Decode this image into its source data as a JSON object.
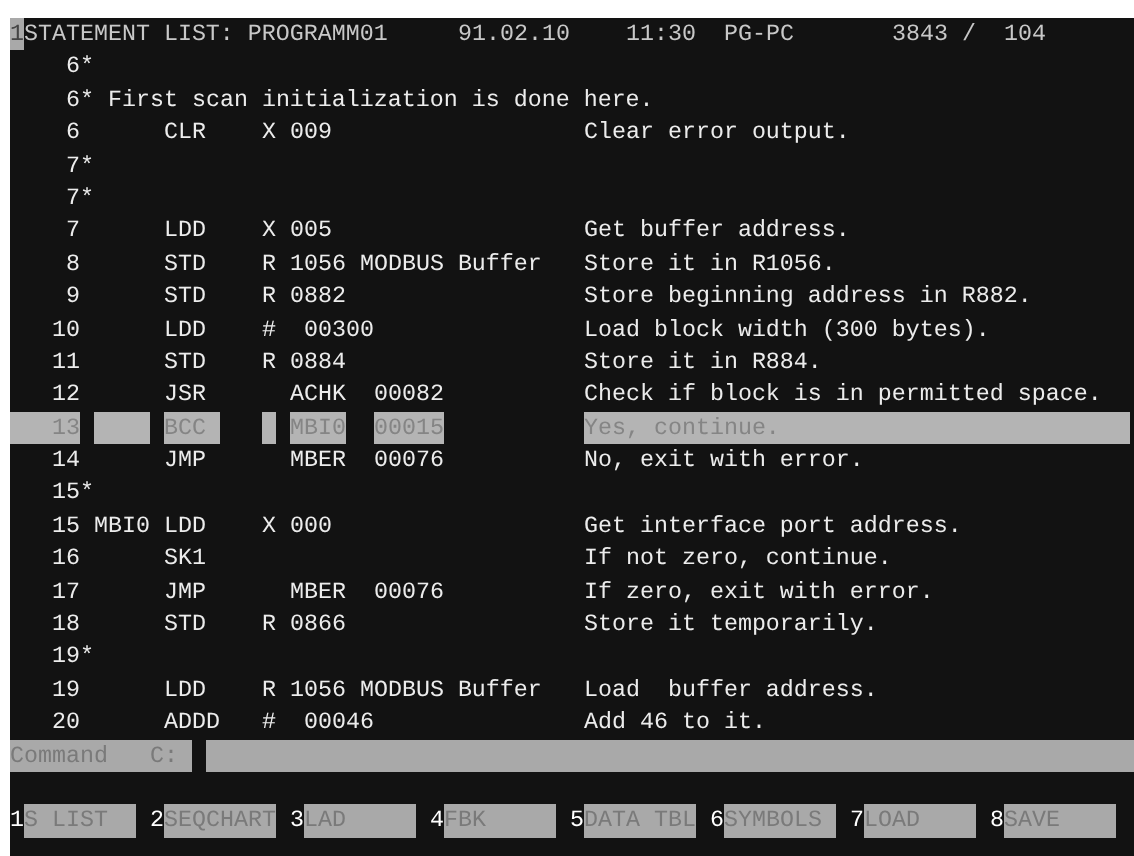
{
  "header": {
    "cursor": "1",
    "title": "STATEMENT LIST: PROGRAMM01",
    "date": "91.02.10",
    "time": "11:30",
    "station": "PG-PC",
    "counter": "3843 /  104"
  },
  "lines": [
    {
      "kind": "comment",
      "number": "6*",
      "selected": false
    },
    {
      "kind": "comment",
      "number": "6*",
      "text": "First scan initialization is done here.",
      "selected": false
    },
    {
      "kind": "statement",
      "number": "6",
      "op": "CLR",
      "type": "X",
      "value": "009",
      "comment": "Clear error output.",
      "selected": false
    },
    {
      "kind": "comment",
      "number": "7*",
      "selected": false
    },
    {
      "kind": "comment",
      "number": "7*",
      "selected": false
    },
    {
      "kind": "statement",
      "number": "7",
      "op": "LDD",
      "type": "X",
      "value": "005",
      "comment": "Get buffer address.",
      "selected": false
    },
    {
      "kind": "statement",
      "number": "8",
      "op": "STD",
      "type": "R",
      "value": "1056 MODBUS Buffer",
      "comment": "Store it in R1056.",
      "selected": false
    },
    {
      "kind": "statement",
      "number": "9",
      "op": "STD",
      "type": "R",
      "value": "0882",
      "comment": "Store beginning address in R882.",
      "selected": false
    },
    {
      "kind": "statement",
      "number": "10",
      "op": "LDD",
      "type": "#",
      "value": "00300",
      "comment": "Load block width (300 bytes).",
      "selected": false
    },
    {
      "kind": "statement",
      "number": "11",
      "op": "STD",
      "type": "R",
      "value": "0884",
      "comment": "Store it in R884.",
      "selected": false
    },
    {
      "kind": "statement",
      "number": "12",
      "op": "JSR",
      "symbol": "ACHK",
      "value": "00082",
      "comment": "Check if block is in permitted space.",
      "selected": false
    },
    {
      "kind": "statement",
      "number": "13",
      "op": "BCC",
      "symbol": "MBI0",
      "value": "00015",
      "comment": "Yes, continue.",
      "selected": true
    },
    {
      "kind": "statement",
      "number": "14",
      "op": "JMP",
      "symbol": "MBER",
      "value": "00076",
      "comment": "No, exit with error.",
      "selected": false
    },
    {
      "kind": "comment",
      "number": "15*",
      "selected": false
    },
    {
      "kind": "statement",
      "number": "15",
      "label": "MBI0",
      "op": "LDD",
      "type": "X",
      "value": "000",
      "comment": "Get interface port address.",
      "selected": false
    },
    {
      "kind": "statement",
      "number": "16",
      "op": "SK1",
      "comment": "If not zero, continue.",
      "selected": false
    },
    {
      "kind": "statement",
      "number": "17",
      "op": "JMP",
      "symbol": "MBER",
      "value": "00076",
      "comment": "If zero, exit with error.",
      "selected": false
    },
    {
      "kind": "statement",
      "number": "18",
      "op": "STD",
      "type": "R",
      "value": "0866",
      "comment": "Store it temporarily.",
      "selected": false
    },
    {
      "kind": "comment",
      "number": "19*",
      "selected": false
    },
    {
      "kind": "statement",
      "number": "19",
      "op": "LDD",
      "type": "R",
      "value": "1056 MODBUS Buffer",
      "comment": "Load  buffer address.",
      "selected": false
    },
    {
      "kind": "statement",
      "number": "20",
      "op": "ADDD",
      "type": "#",
      "value": "00046",
      "comment": "Add 46 to it.",
      "selected": false
    }
  ],
  "command": {
    "label": "Command",
    "drive": "C:"
  },
  "function_keys": [
    {
      "key": "1",
      "label": "S LIST"
    },
    {
      "key": "2",
      "label": "SEQCHART"
    },
    {
      "key": "3",
      "label": "LAD"
    },
    {
      "key": "4",
      "label": "FBK"
    },
    {
      "key": "5",
      "label": "DATA TBL"
    },
    {
      "key": "6",
      "label": "SYMBOLS"
    },
    {
      "key": "7",
      "label": "LOAD"
    },
    {
      "key": "8",
      "label": "SAVE"
    }
  ]
}
